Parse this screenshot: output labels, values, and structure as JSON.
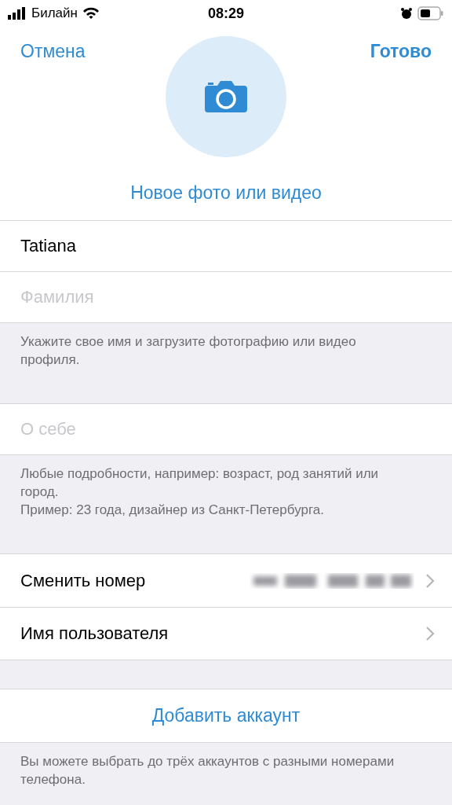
{
  "status_bar": {
    "carrier": "Билайн",
    "time": "08:29"
  },
  "header": {
    "cancel": "Отмена",
    "done": "Готово",
    "photo_link": "Новое фото или видео"
  },
  "name_fields": [
    {
      "value": "Tatiana"
    },
    {
      "placeholder": "Фамилия"
    }
  ],
  "name_note": "Укажите свое имя и загрузите фотографию или видео профиля.",
  "bio_field": {
    "placeholder": "О себе"
  },
  "bio_note": [
    "Любые подробности, например: возраст, род занятий или город.",
    "Пример: 23 года, дизайнер из Санкт-Петербурга."
  ],
  "settings": [
    {
      "label": "Сменить номер",
      "blurred_value": true
    },
    {
      "label": "Имя пользователя",
      "blurred_value": false
    }
  ],
  "add_account": "Добавить аккаунт",
  "account_note": "Вы можете выбрать до трёх аккаунтов с разными номерами телефона."
}
